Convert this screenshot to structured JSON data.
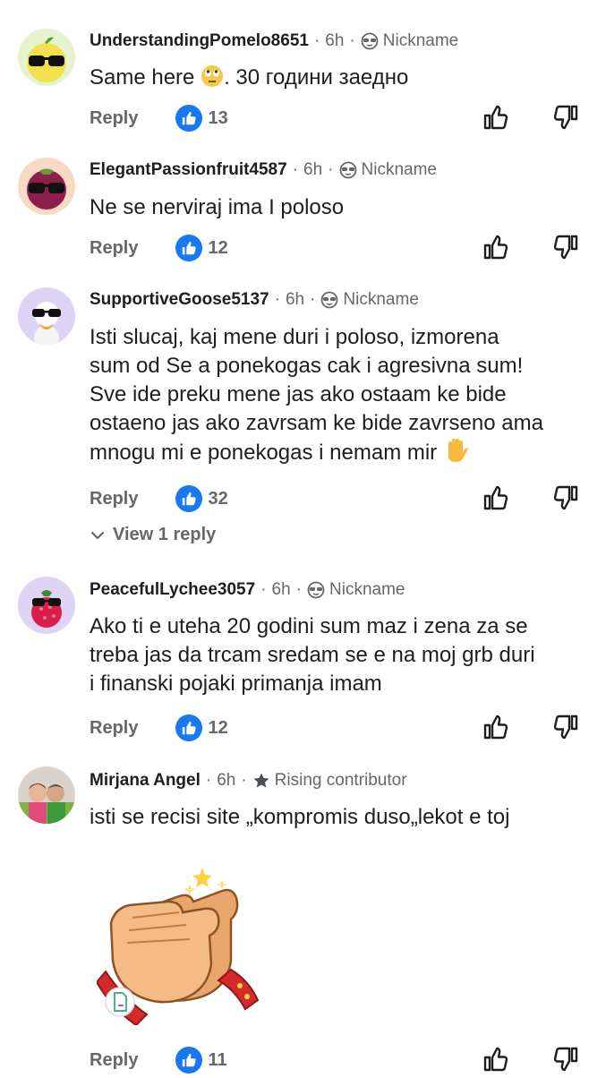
{
  "comments": [
    {
      "author": "UnderstandingPomelo8651",
      "time": "6h",
      "badge": "Nickname",
      "text": "Same here",
      "text_after": ". 30 години заедно",
      "likes": "13",
      "reply_label": "Reply"
    },
    {
      "author": "ElegantPassionfruit4587",
      "time": "6h",
      "badge": "Nickname",
      "text": "Ne se nerviraj  ima I poloso",
      "likes": "12",
      "reply_label": "Reply"
    },
    {
      "author": "SupportiveGoose5137",
      "time": "6h",
      "badge": "Nickname",
      "text_lines": [
        "Isti slucaj, kaj mene duri i poloso, izmorena",
        "sum od Se a ponekogas cak i agresivna sum!",
        "Sve ide preku mene jas ako ostaam ke bide",
        "ostaeno jas ako zavrsam ke bide zavrseno ama",
        "mnogu mi e ponekogas i nemam mir"
      ],
      "likes": "32",
      "reply_label": "Reply",
      "view_replies": "View 1 reply"
    },
    {
      "author": "PeacefulLychee3057",
      "time": "6h",
      "badge": "Nickname",
      "text_lines": [
        "Ako ti e uteha 20 godini sum maz i zena za se",
        "treba jas da trcam sredam se e na moj grb duri",
        "i finanski pojaki primanja imam"
      ],
      "likes": "12",
      "reply_label": "Reply"
    },
    {
      "author": "Mirjana Angel",
      "time": "6h",
      "badge": "Rising contributor",
      "text": "isti se recisi site „kompromis duso„lekot e toj",
      "likes": "11",
      "reply_label": "Reply"
    }
  ],
  "icons": {
    "nickname": "sunglasses-face-icon",
    "rising": "star-icon",
    "like": "thumbs-up-icon",
    "dislike": "thumbs-down-icon",
    "reply_toggle": "chevron-down-icon"
  },
  "colors": {
    "accent": "#1877f2",
    "meta": "#65676b",
    "text": "#1c1e21"
  }
}
